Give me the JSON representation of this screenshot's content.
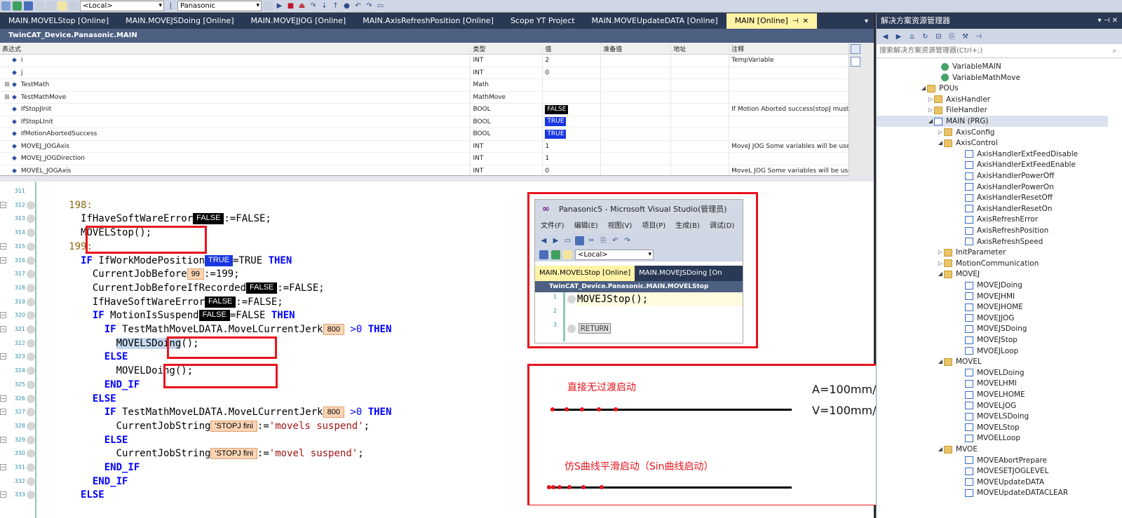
{
  "toolbar": {
    "platform": "<Local>",
    "project": "Panasonic"
  },
  "tabs": [
    {
      "label": "MAIN.MOVELStop [Online]"
    },
    {
      "label": "MAIN.MOVEJSDoing [Online]"
    },
    {
      "label": "MAIN.MOVEJJOG [Online]"
    },
    {
      "label": "MAIN.AxisRefreshPosition [Online]"
    },
    {
      "label": "Scope YT Project"
    },
    {
      "label": "MAIN.MOVEUpdateDATA [Online]"
    },
    {
      "label": "MAIN [Online]"
    }
  ],
  "breadcrumb": "TwinCAT_Device.Panasonic.MAIN",
  "watch": {
    "headers": [
      "表达式",
      "类型",
      "值",
      "准备值",
      "地址",
      "注释"
    ],
    "rows": [
      {
        "name": "i",
        "type": "INT",
        "value": "2",
        "comment": "TempVariable"
      },
      {
        "name": "j",
        "type": "INT",
        "value": "0",
        "comment": ""
      },
      {
        "name": "TestMath",
        "type": "Math",
        "value": "",
        "comment": ""
      },
      {
        "name": "TestMathMove",
        "type": "MathMove",
        "value": "",
        "comment": ""
      },
      {
        "name": "IfStopJInit",
        "type": "BOOL",
        "value": "FALSE",
        "comment": "If Motion Aborted success(stopJ must be"
      },
      {
        "name": "IfStopLInit",
        "type": "BOOL",
        "value": "TRUE",
        "comment": ""
      },
      {
        "name": "IfMotionAbortedSuccess",
        "type": "BOOL",
        "value": "TRUE",
        "comment": ""
      },
      {
        "name": "MOVEJ_JOGAxis",
        "type": "INT",
        "value": "1",
        "comment": "MoveJ JOG Some variables will be used"
      },
      {
        "name": "MOVEJ_JOGDirection",
        "type": "INT",
        "value": "1",
        "comment": ""
      },
      {
        "name": "MOVEL_JOGAxis",
        "type": "INT",
        "value": "0",
        "comment": "MoveL JOG Some variables will be use"
      }
    ]
  },
  "code": {
    "line_numbers": [
      "311",
      "312",
      "313",
      "314",
      "315",
      "316",
      "317",
      "318",
      "319",
      "320",
      "321",
      "322",
      "323",
      "324",
      "325",
      "326",
      "327",
      "328",
      "329",
      "330",
      "331",
      "332",
      "333"
    ],
    "l312": "198:",
    "l313_var": "IfHaveSoftWareError",
    "l313_val": "FALSE",
    "l313_rest": ":=FALSE;",
    "l314_call": "MOVELStop",
    "l314_rest": "();",
    "l315": "199:",
    "l316_kw": "IF",
    "l316_var": "IfWorkModePosition",
    "l316_val": "TRUE",
    "l316_rest": "=TRUE",
    "l316_then": "THEN",
    "l317_var": "CurrentJobBefore",
    "l317_val": "99",
    "l317_rest": ":=199;",
    "l318_var": "CurrentJobBeforeIfRecorded",
    "l318_val": "FALSE",
    "l318_rest": ":=FALSE;",
    "l319_var": "IfHaveSoftWareError",
    "l319_val": "FALSE",
    "l319_rest": ":=FALSE;",
    "l320_kw": "IF",
    "l320_var": "MotionIsSuspend",
    "l320_val": "FALSE",
    "l320_rest": "=FALSE",
    "l320_then": "THEN",
    "l321_kw": "IF",
    "l321_var": "TestMathMoveLDATA.MoveLCurrentJerk",
    "l321_val": "800",
    "l321_rest": ">0",
    "l321_then": "THEN",
    "l322_call": "MOVELSDoing",
    "l322_rest": "();",
    "l323_kw": "ELSE",
    "l324_call": "MOVELDoing",
    "l324_rest": "();",
    "l325_kw": "END_IF",
    "l326_kw": "ELSE",
    "l327_kw": "IF",
    "l327_var": "TestMathMoveLDATA.MoveLCurrentJerk",
    "l327_val": "800",
    "l327_rest": ">0",
    "l327_then": "THEN",
    "l328_var": "CurrentJobString",
    "l328_val": "'STOPJ fini",
    "l328_op": ":=",
    "l328_str": "'movels suspend'",
    "l328_end": ";",
    "l329_kw": "ELSE",
    "l330_var": "CurrentJobString",
    "l330_val": "'STOPJ fini",
    "l330_op": ":=",
    "l330_str": "'movel suspend'",
    "l330_end": ";",
    "l331_kw": "END_IF",
    "l332_kw": "END_IF",
    "l333_kw": "ELSE"
  },
  "popup": {
    "title": "Panasonic5 - Microsoft Visual Studio(管理员)",
    "menu": [
      "文件(F)",
      "编辑(E)",
      "视图(V)",
      "项目(P)",
      "生成(B)",
      "调试(D)"
    ],
    "platform": "<Local>",
    "tab_active": "MAIN.MOVELStop [Online]",
    "tab_next": "MAIN.MOVEJSDoing [On",
    "crumb": "TwinCAT_Device.Panasonic.MAIN.MOVELStop",
    "line1": "MOVEJStop();",
    "return_label": "RETURN",
    "ln1": "1",
    "ln2": "2",
    "ln3": "3"
  },
  "annotation": {
    "label_direct": "直接无过渡启动",
    "label_s": "仿S曲线平滑启动（Sin曲线启动）",
    "accel": "A=100mm/s^2",
    "vel": "V=100mm/s",
    "accent_color": "#e8141c"
  },
  "solution": {
    "title": "解决方案资源管理器",
    "search_placeholder": "搜索解决方案资源管理器(Ctrl+;)",
    "items": [
      {
        "label": "VariableMAIN",
        "icon": "gv"
      },
      {
        "label": "VariableMathMove",
        "icon": "gv"
      },
      {
        "label": "POUs",
        "icon": "folder"
      },
      {
        "label": "AxisHandler",
        "icon": "folder"
      },
      {
        "label": "FileHandler",
        "icon": "folder"
      },
      {
        "label": "MAIN (PRG)",
        "icon": "file"
      },
      {
        "label": "AxisConfig",
        "icon": "folder"
      },
      {
        "label": "AxisControl",
        "icon": "folder"
      },
      {
        "label": "AxisHandlerExtFeedDisable",
        "icon": "file"
      },
      {
        "label": "AxisHandlerExtFeedEnable",
        "icon": "file"
      },
      {
        "label": "AxisHandlerPowerOff",
        "icon": "file"
      },
      {
        "label": "AxisHandlerPowerOn",
        "icon": "file"
      },
      {
        "label": "AxisHandlerResetOff",
        "icon": "file"
      },
      {
        "label": "AxisHandlerResetOn",
        "icon": "file"
      },
      {
        "label": "AxisRefreshError",
        "icon": "file"
      },
      {
        "label": "AxisRefreshPosition",
        "icon": "file"
      },
      {
        "label": "AxisRefreshSpeed",
        "icon": "file"
      },
      {
        "label": "InitParameter",
        "icon": "folder"
      },
      {
        "label": "MotionCommunication",
        "icon": "folder"
      },
      {
        "label": "MOVEJ",
        "icon": "folder"
      },
      {
        "label": "MOVEJDoing",
        "icon": "file"
      },
      {
        "label": "MOVEJHMI",
        "icon": "file"
      },
      {
        "label": "MOVEJHOME",
        "icon": "file"
      },
      {
        "label": "MOVEJJOG",
        "icon": "file"
      },
      {
        "label": "MOVEJSDoing",
        "icon": "file"
      },
      {
        "label": "MOVEJStop",
        "icon": "file"
      },
      {
        "label": "MVOEJLoop",
        "icon": "file"
      },
      {
        "label": "MOVEL",
        "icon": "folder"
      },
      {
        "label": "MOVELDoing",
        "icon": "file"
      },
      {
        "label": "MOVELHMI",
        "icon": "file"
      },
      {
        "label": "MOVELHOME",
        "icon": "file"
      },
      {
        "label": "MOVELJOG",
        "icon": "file"
      },
      {
        "label": "MOVELSDoing",
        "icon": "file"
      },
      {
        "label": "MOVELStop",
        "icon": "file"
      },
      {
        "label": "MVOELLoop",
        "icon": "file"
      },
      {
        "label": "MVOE",
        "icon": "folder"
      },
      {
        "label": "MOVEAbortPrepare",
        "icon": "file"
      },
      {
        "label": "MOVESETJOGLEVEL",
        "icon": "file"
      },
      {
        "label": "MOVEUpdateDATA",
        "icon": "file"
      },
      {
        "label": "MOVEUpdateDATACLEAR",
        "icon": "file"
      }
    ]
  }
}
